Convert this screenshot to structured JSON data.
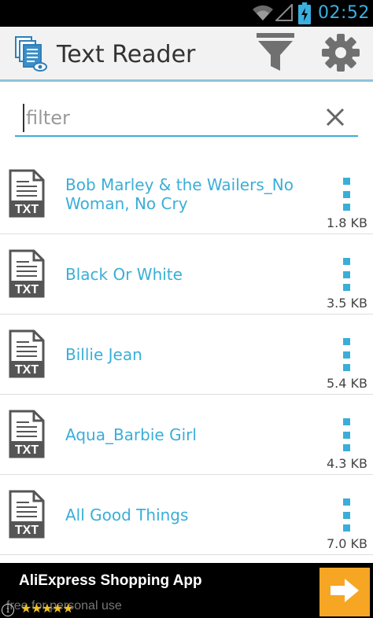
{
  "status_bar": {
    "time": "02:52",
    "icons": [
      "wifi-icon",
      "signal-icon",
      "battery-charging-icon"
    ]
  },
  "action_bar": {
    "title": "Text Reader",
    "icons": [
      "app-documents-icon",
      "filter-funnel-icon",
      "settings-gear-icon"
    ]
  },
  "search": {
    "placeholder": "filter",
    "value": ""
  },
  "files": [
    {
      "name": "Bob Marley & the Wailers_No Woman, No Cry",
      "size": "1.8 KB",
      "type": "TXT"
    },
    {
      "name": "Black Or White",
      "size": "3.5 KB",
      "type": "TXT"
    },
    {
      "name": "Billie Jean",
      "size": "5.4 KB",
      "type": "TXT"
    },
    {
      "name": "Aqua_Barbie Girl",
      "size": "4.3 KB",
      "type": "TXT"
    },
    {
      "name": "All Good Things",
      "size": "7.0 KB",
      "type": "TXT"
    }
  ],
  "ad": {
    "title": "AliExpress Shopping App",
    "subtitle": "free for personal use",
    "stars": "★★★★★",
    "info": "i"
  },
  "colors": {
    "accent": "#3aaed8",
    "status_time": "#3ab0e0",
    "action_bar_bg": "#f2f2f2",
    "ad_button": "#f6a623"
  }
}
